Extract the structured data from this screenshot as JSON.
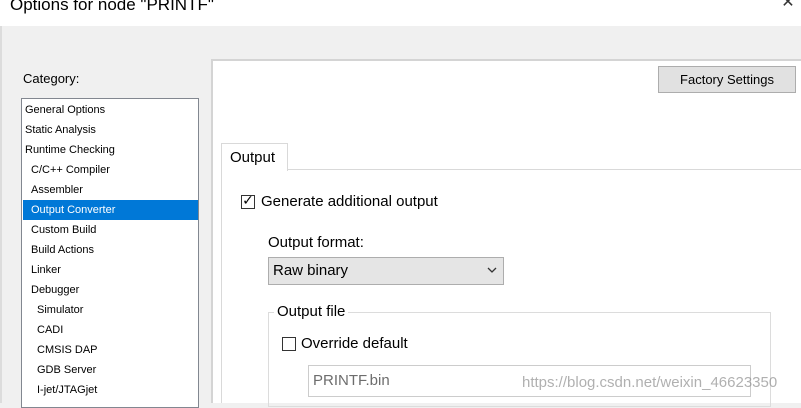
{
  "window": {
    "title": "Options for node \"PRINTF\""
  },
  "category": {
    "label": "Category:",
    "items": [
      {
        "label": "General Options"
      },
      {
        "label": "Static Analysis"
      },
      {
        "label": "Runtime Checking"
      },
      {
        "label": "C/C++ Compiler"
      },
      {
        "label": "Assembler"
      },
      {
        "label": "Output Converter",
        "selected": true
      },
      {
        "label": "Custom Build"
      },
      {
        "label": "Build Actions"
      },
      {
        "label": "Linker"
      },
      {
        "label": "Debugger"
      },
      {
        "label": "Simulator"
      },
      {
        "label": "CADI"
      },
      {
        "label": "CMSIS DAP"
      },
      {
        "label": "GDB Server"
      },
      {
        "label": "I-jet/JTAGjet"
      }
    ]
  },
  "panel": {
    "factory_settings_label": "Factory Settings",
    "tabs": [
      {
        "label": "Output"
      }
    ],
    "generate_additional_output": {
      "label": "Generate additional output",
      "checked": true
    },
    "output_format": {
      "label": "Output format:",
      "value": "Raw binary"
    },
    "output_file": {
      "group_label": "Output file",
      "override_default": {
        "label": "Override default",
        "checked": false
      },
      "file_name": "PRINTF.bin"
    }
  },
  "watermark": "https://blog.csdn.net/weixin_46623350",
  "colors": {
    "selection": "#0078d7",
    "window_bg": "#f0f0f0"
  },
  "icons": {
    "close": "close-icon",
    "dropdown": "chevron-down-icon",
    "check": "checkmark-icon"
  }
}
